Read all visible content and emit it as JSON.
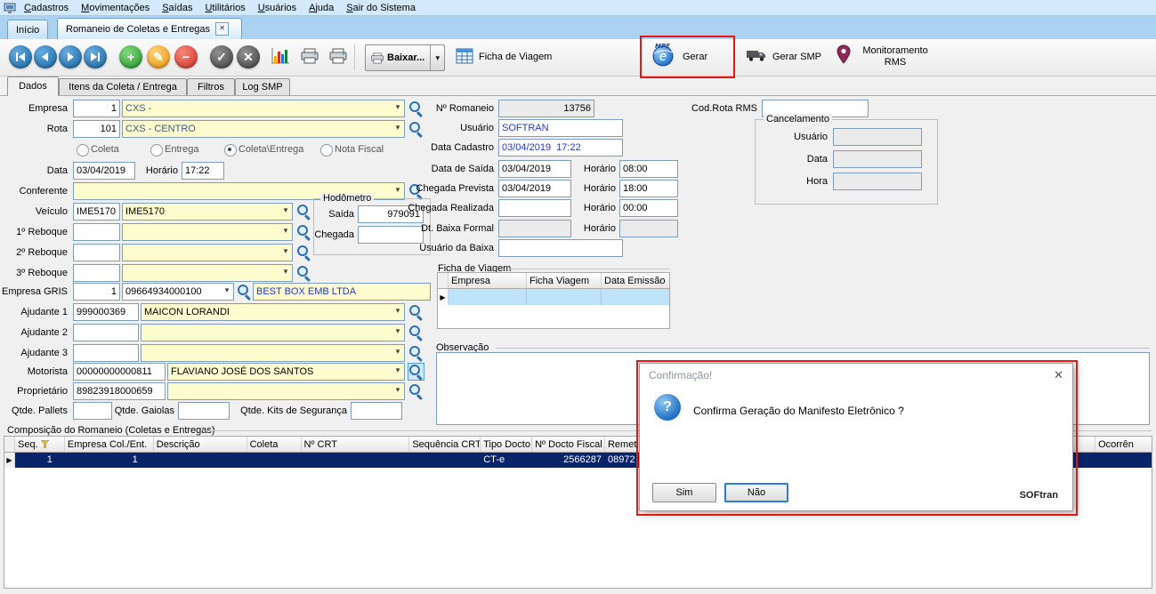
{
  "window": {
    "menu": [
      "Cadastros",
      "Movimentações",
      "Saídas",
      "Utilitários",
      "Usuários",
      "Ajuda",
      "Sair do Sistema"
    ]
  },
  "tabs": {
    "inicio": "Início",
    "romaneio": "Romaneio de Coletas e Entregas"
  },
  "toolbar": {
    "baixar": "Baixar...",
    "ficha_viagem": "Ficha de Viagem",
    "gerar": "Gerar",
    "gerar_smp": "Gerar SMP",
    "monitoramento_rms": "Monitoramento RMS"
  },
  "form_tabs": {
    "dados": "Dados",
    "itens": "Itens da Coleta / Entrega",
    "filtros": "Filtros",
    "log_smp": "Log SMP"
  },
  "form": {
    "empresa": {
      "label": "Empresa",
      "code": "1",
      "name": "CXS -"
    },
    "rota": {
      "label": "Rota",
      "code": "101",
      "name": "CXS - CENTRO"
    },
    "tipos": {
      "coleta": "Coleta",
      "entrega": "Entrega",
      "coleta_entrega": "Coleta\\Entrega",
      "nota_fiscal": "Nota Fiscal"
    },
    "data": {
      "label": "Data",
      "value": "03/04/2019",
      "horario_label": "Horário",
      "horario": "17:22"
    },
    "conferente": {
      "label": "Conferente",
      "value": ""
    },
    "veiculo": {
      "label": "Veículo",
      "code": "IME5170",
      "name": "IME5170"
    },
    "reboque1": {
      "label": "1º Reboque",
      "code": "",
      "name": ""
    },
    "reboque2": {
      "label": "2º Reboque",
      "code": "",
      "name": ""
    },
    "reboque3": {
      "label": "3º Reboque",
      "code": "",
      "name": ""
    },
    "hodometro": {
      "title": "Hodômetro",
      "saida_label": "Saída",
      "saida": "979091",
      "chegada_label": "Chegada",
      "chegada": ""
    },
    "empresa_gris": {
      "label": "Empresa GRIS",
      "code": "1",
      "cnpj": "09664934000100",
      "name": "BEST BOX EMB LTDA"
    },
    "ajudante1": {
      "label": "Ajudante 1",
      "code": "999000369",
      "name": "MAICON LORANDI"
    },
    "ajudante2": {
      "label": "Ajudante 2",
      "code": "",
      "name": ""
    },
    "ajudante3": {
      "label": "Ajudante 3",
      "code": "",
      "name": ""
    },
    "motorista": {
      "label": "Motorista",
      "code": "00000000000811",
      "name": "FLAVIANO JOSÉ DOS SANTOS"
    },
    "proprietario": {
      "label": "Proprietário",
      "code": "89823918000659",
      "name": ""
    },
    "qtde_pallets": {
      "label": "Qtde. Pallets",
      "value": ""
    },
    "qtde_gaiolas": {
      "label": "Qtde. Gaiolas",
      "value": ""
    },
    "qtde_kits": {
      "label": "Qtde. Kits de Segurança",
      "value": ""
    }
  },
  "detail": {
    "romaneio": {
      "label": "Nº Romaneio",
      "value": "13756"
    },
    "usuario": {
      "label": "Usuário",
      "value": "SOFTRAN"
    },
    "data_cadastro": {
      "label": "Data Cadastro",
      "value": "03/04/2019  17:22"
    },
    "data_saida": {
      "label": "Data de Saída",
      "value": "03/04/2019",
      "horario_label": "Horário",
      "horario": "08:00"
    },
    "chegada_prevista": {
      "label": "Chegada Prevista",
      "value": "03/04/2019",
      "horario_label": "Horário",
      "horario": "18:00"
    },
    "chegada_realizada": {
      "label": "Chegada Realizada",
      "value": "",
      "horario_label": "Horário",
      "horario": "00:00"
    },
    "dt_baixa": {
      "label": "Dt. Baixa Formal",
      "value": "",
      "horario_label": "Horário",
      "horario": ""
    },
    "usuario_baixa": {
      "label": "Usuário da Baixa",
      "value": ""
    },
    "ficha_viagem": {
      "title": "Ficha de Viagem",
      "col_empresa": "Empresa",
      "col_ficha": "Ficha Viagem",
      "col_emissao": "Data Emissão"
    },
    "observacao": {
      "label": "Observação",
      "value": ""
    },
    "cod_rota_rms": {
      "label": "Cod.Rota RMS",
      "value": ""
    },
    "cancelamento": {
      "title": "Cancelamento",
      "usuario_label": "Usuário",
      "usuario": "",
      "data_label": "Data",
      "data": "",
      "hora_label": "Hora",
      "hora": ""
    }
  },
  "grid": {
    "title": "Composição do Romaneio (Coletas e Entregas)",
    "columns": {
      "seq": "Seq.",
      "empresa": "Empresa Col./Ent.",
      "descricao": "Descrição",
      "coleta": "Coleta",
      "crt": "Nº CRT",
      "seq_crt": "Sequência CRT",
      "tipo_docto": "Tipo Docto",
      "docto_fiscal": "Nº Docto Fiscal",
      "remetente": "Remet",
      "ocorrencia": "Ocorrên"
    },
    "row1": {
      "seq": "1",
      "empresa": "1",
      "tipo_docto": "CT-e",
      "docto_fiscal": "2566287",
      "remetente": "08972"
    }
  },
  "dialog": {
    "title": "Confirmação!",
    "message": "Confirma Geração do Manifesto Eletrônico ?",
    "yes": "Sim",
    "no": "Não",
    "brand": "SOFtran"
  }
}
